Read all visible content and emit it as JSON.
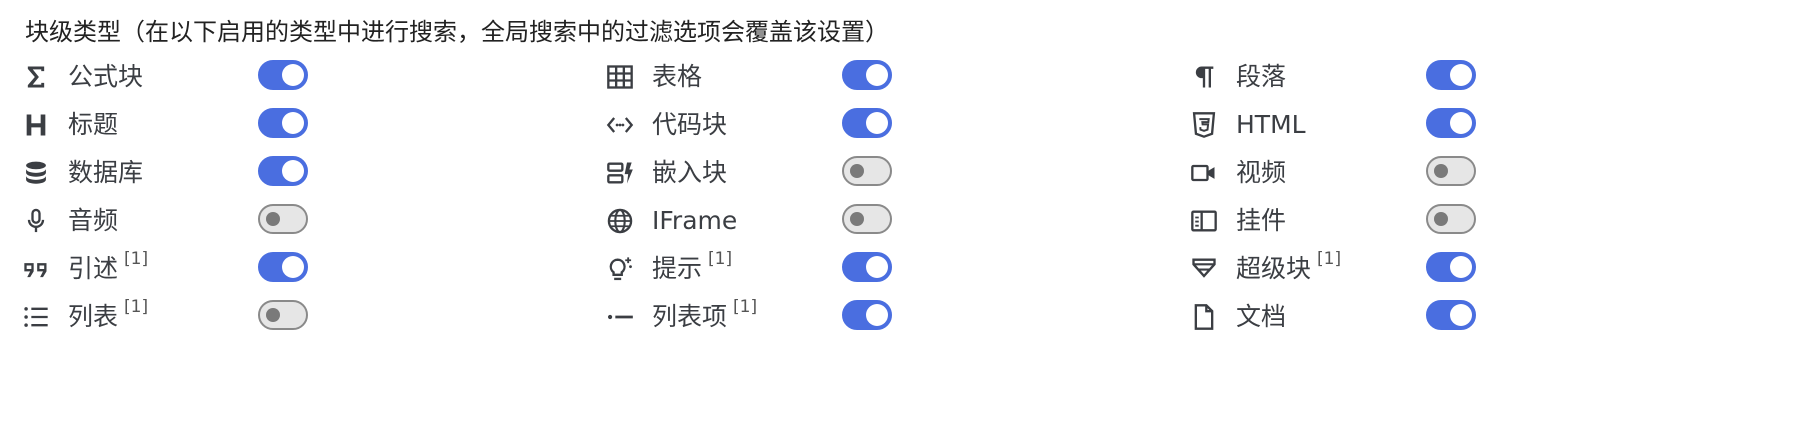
{
  "title": "块级类型（在以下启用的类型中进行搜索，全局搜索中的过滤选项会覆盖该设置）",
  "columns": [
    {
      "items": [
        {
          "icon": "sigma-icon",
          "label": "公式块",
          "note": "",
          "enabled": true
        },
        {
          "icon": "heading-icon",
          "label": "标题",
          "note": "",
          "enabled": true
        },
        {
          "icon": "database-icon",
          "label": "数据库",
          "note": "",
          "enabled": true
        },
        {
          "icon": "microphone-icon",
          "label": "音频",
          "note": "",
          "enabled": false
        },
        {
          "icon": "quote-icon",
          "label": "引述",
          "note": "[1]",
          "enabled": true
        },
        {
          "icon": "list-icon",
          "label": "列表",
          "note": "[1]",
          "enabled": false
        }
      ]
    },
    {
      "items": [
        {
          "icon": "table-icon",
          "label": "表格",
          "note": "",
          "enabled": true
        },
        {
          "icon": "code-icon",
          "label": "代码块",
          "note": "",
          "enabled": true
        },
        {
          "icon": "embed-icon",
          "label": "嵌入块",
          "note": "",
          "enabled": false
        },
        {
          "icon": "globe-icon",
          "label": "IFrame",
          "note": "",
          "enabled": false
        },
        {
          "icon": "lightbulb-icon",
          "label": "提示",
          "note": "[1]",
          "enabled": true
        },
        {
          "icon": "list-item-icon",
          "label": "列表项",
          "note": "[1]",
          "enabled": true
        }
      ]
    },
    {
      "items": [
        {
          "icon": "paragraph-icon",
          "label": "段落",
          "note": "",
          "enabled": true
        },
        {
          "icon": "html5-icon",
          "label": "HTML",
          "note": "",
          "enabled": true
        },
        {
          "icon": "video-icon",
          "label": "视频",
          "note": "",
          "enabled": false
        },
        {
          "icon": "widget-icon",
          "label": "挂件",
          "note": "",
          "enabled": false
        },
        {
          "icon": "superblock-icon",
          "label": "超级块",
          "note": "[1]",
          "enabled": true
        },
        {
          "icon": "document-icon",
          "label": "文档",
          "note": "",
          "enabled": true
        }
      ]
    }
  ],
  "colors": {
    "accent": "#4a6ee0",
    "toggle_off": "#e6e6e6",
    "icon": "#3b3e43"
  }
}
